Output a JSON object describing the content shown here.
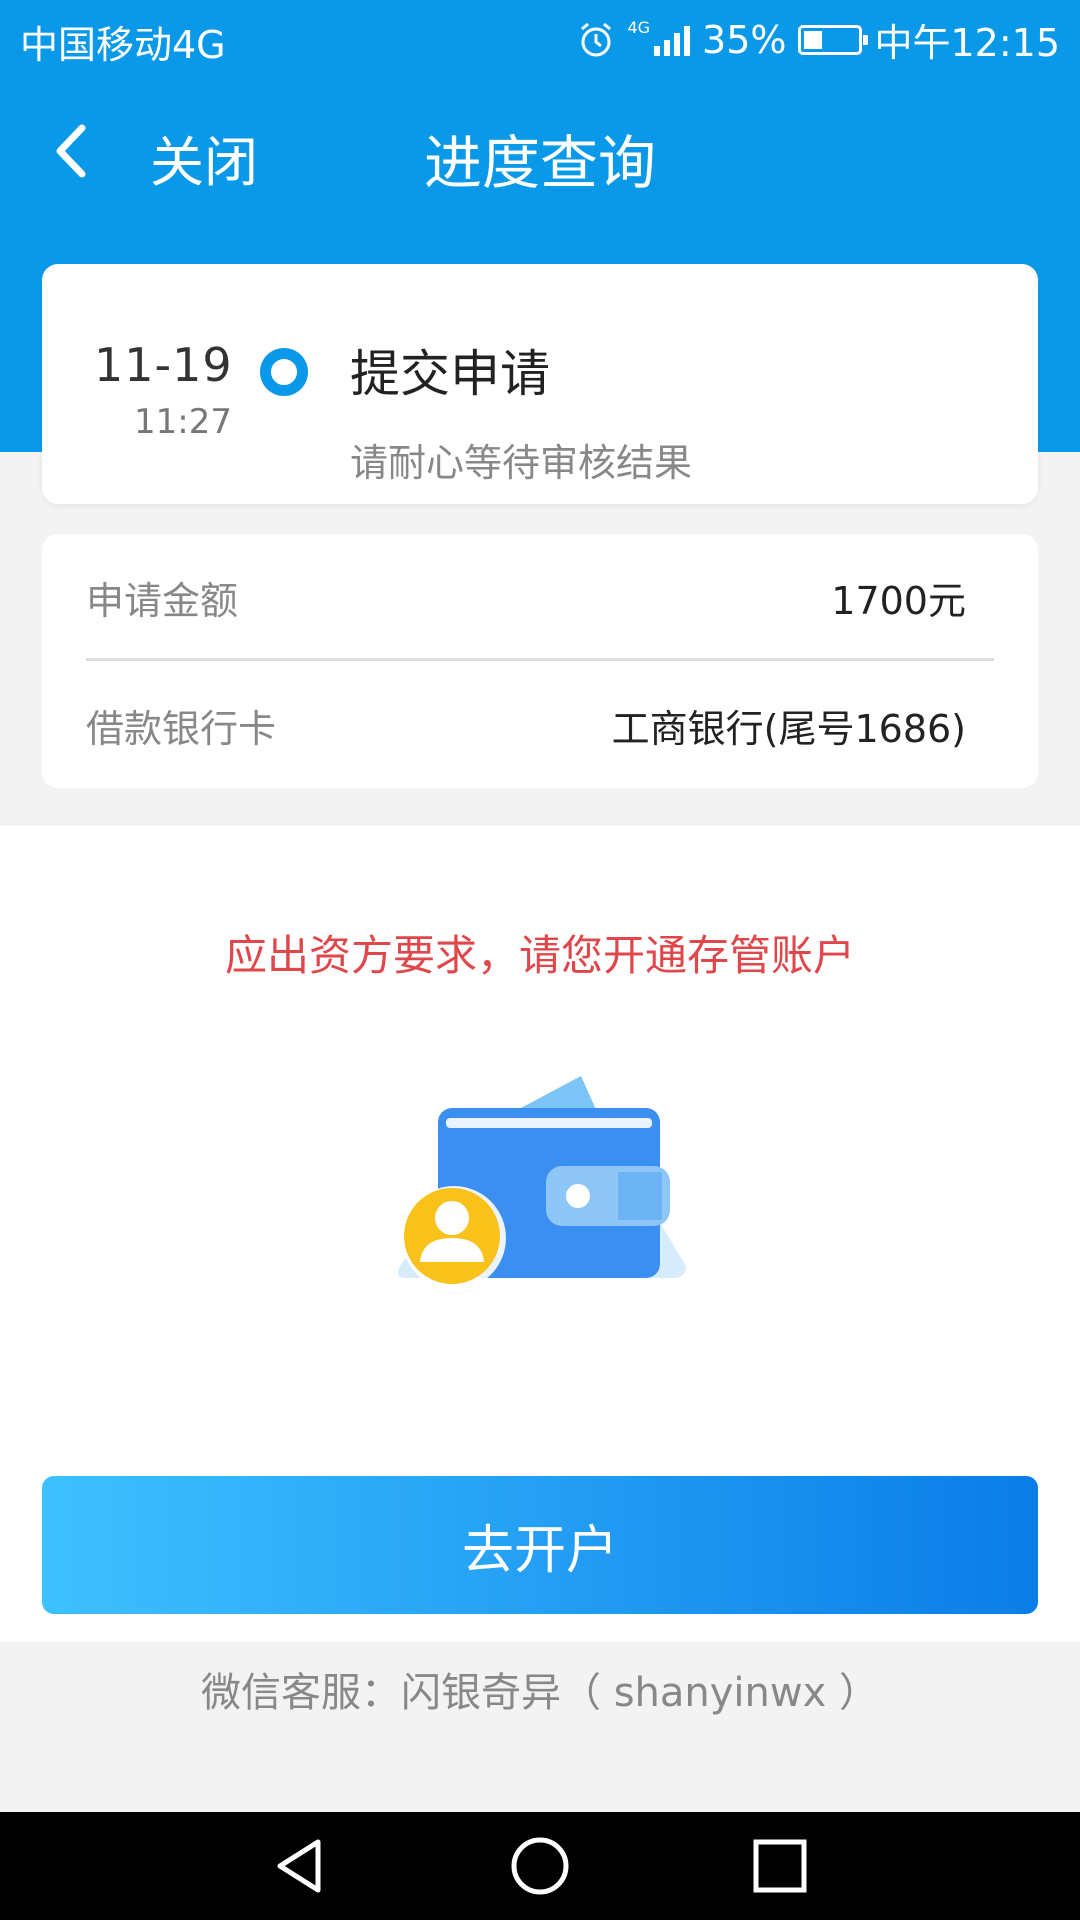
{
  "status_bar": {
    "carrier": "中国移动4G",
    "network_badge": "4G",
    "battery": "35%",
    "time": "中午12:15"
  },
  "header": {
    "close_label": "关闭",
    "title": "进度查询"
  },
  "timeline": {
    "date": "11-19",
    "time": "11:27",
    "title": "提交申请",
    "description": "请耐心等待审核结果"
  },
  "info": {
    "rows": [
      {
        "label": "申请金额",
        "value": "1700元"
      },
      {
        "label": "借款银行卡",
        "value": "工商银行(尾号1686)"
      }
    ]
  },
  "notice": "应出资方要求，请您开通存管账户",
  "illustration": {
    "icon": "wallet-icon"
  },
  "cta": {
    "label": "去开户"
  },
  "service": "微信客服：闪银奇异（ shanyinwx ）",
  "colors": {
    "primary": "#0a99e8",
    "notice": "#e0474b",
    "button_start": "#3ec1ff",
    "button_end": "#0a7de8"
  }
}
